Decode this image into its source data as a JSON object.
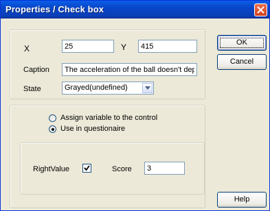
{
  "window": {
    "title": "Properties / Check box"
  },
  "position": {
    "x_label": "X",
    "x_value": "25",
    "y_label": "Y",
    "y_value": "415"
  },
  "caption": {
    "label": "Caption",
    "value": "The acceleration of the ball doesn't depend"
  },
  "state": {
    "label": "State",
    "value": "Grayed(undefined)"
  },
  "options": {
    "assign_variable_label": "Assign variable to the control",
    "use_in_questionnaire_label": "Use in questionaire",
    "selected": "use_in_questionnaire"
  },
  "questionnaire": {
    "right_value_label": "RightValue",
    "right_value_checked": true,
    "score_label": "Score",
    "score_value": "3"
  },
  "buttons": {
    "ok": "OK",
    "cancel": "Cancel",
    "help": "Help"
  }
}
